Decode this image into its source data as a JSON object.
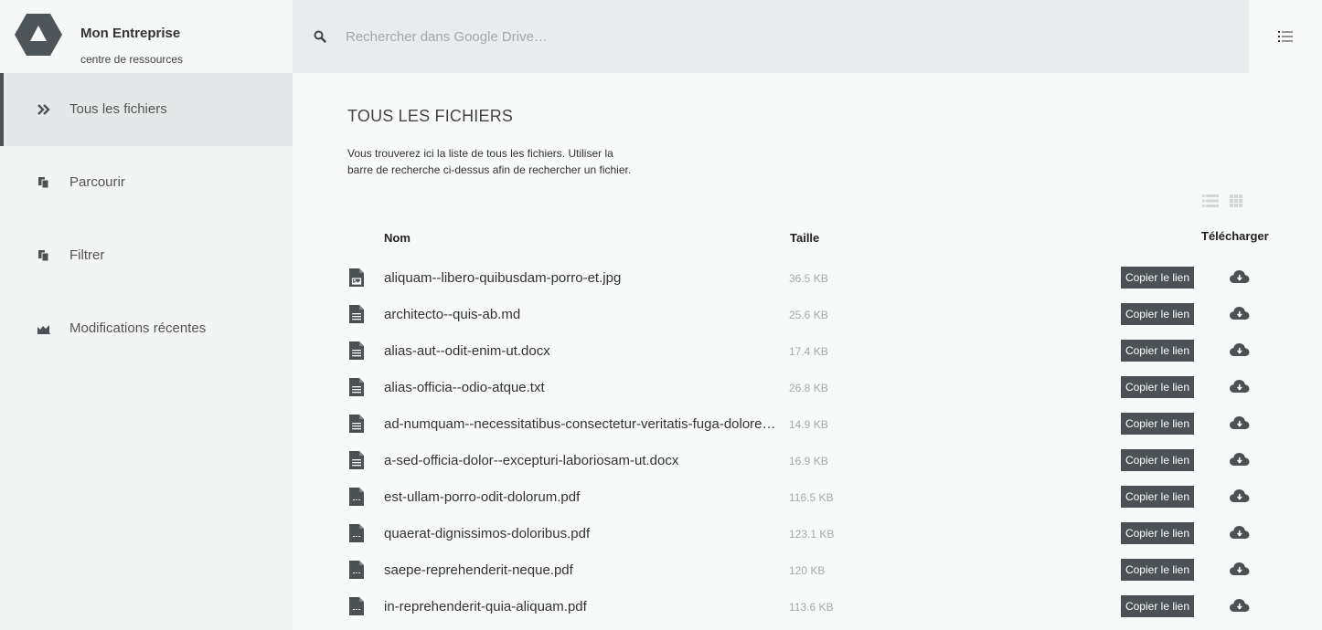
{
  "brand": {
    "title": "Mon Entreprise",
    "subtitle": "centre de ressources",
    "logo_icon": "drive-triangle-icon"
  },
  "nav": {
    "items": [
      {
        "label": "Tous les fichiers",
        "icon": "double-chevron-right-icon",
        "active": true
      },
      {
        "label": "Parcourir",
        "icon": "copy-files-icon",
        "active": false
      },
      {
        "label": "Filtrer",
        "icon": "copy-files-icon",
        "active": false
      },
      {
        "label": "Modifications récentes",
        "icon": "area-chart-icon",
        "active": false
      }
    ]
  },
  "search": {
    "placeholder": "Rechercher dans Google Drive…",
    "value": ""
  },
  "main": {
    "title": "TOUS LES FICHIERS",
    "description_line1": "Vous trouverez ici la liste de tous les fichiers. Utiliser la",
    "description_line2": "barre de recherche ci-dessus afin de rechercher un fichier."
  },
  "table": {
    "headers": {
      "name": "Nom",
      "size": "Taille",
      "download": "Télécharger"
    },
    "copy_label": "Copier le lien",
    "files": [
      {
        "name": "aliquam--libero-quibusdam-porro-et.jpg",
        "size": "36.5 KB",
        "type": "image"
      },
      {
        "name": "architecto--quis-ab.md",
        "size": "25.6 KB",
        "type": "text"
      },
      {
        "name": "alias-aut--odit-enim-ut.docx",
        "size": "17.4 KB",
        "type": "text"
      },
      {
        "name": "alias-officia--odio-atque.txt",
        "size": "26.8 KB",
        "type": "text"
      },
      {
        "name": "ad-numquam--necessitatibus-consectetur-veritatis-fuga-dolorem…",
        "size": "14.9 KB",
        "type": "text"
      },
      {
        "name": "a-sed-officia-dolor--excepturi-laboriosam-ut.docx",
        "size": "16.9 KB",
        "type": "text"
      },
      {
        "name": "est-ullam-porro-odit-dolorum.pdf",
        "size": "116.5 KB",
        "type": "pdf"
      },
      {
        "name": "quaerat-dignissimos-doloribus.pdf",
        "size": "123.1 KB",
        "type": "pdf"
      },
      {
        "name": "saepe-reprehenderit-neque.pdf",
        "size": "120 KB",
        "type": "pdf"
      },
      {
        "name": "in-reprehenderit-quia-aliquam.pdf",
        "size": "113.6 KB",
        "type": "pdf"
      }
    ]
  },
  "colors": {
    "accent": "#4b5155",
    "sidebar_bg": "#f3f4f4",
    "topbar_bg": "#e9ebec",
    "muted_text": "#a6aaac"
  }
}
